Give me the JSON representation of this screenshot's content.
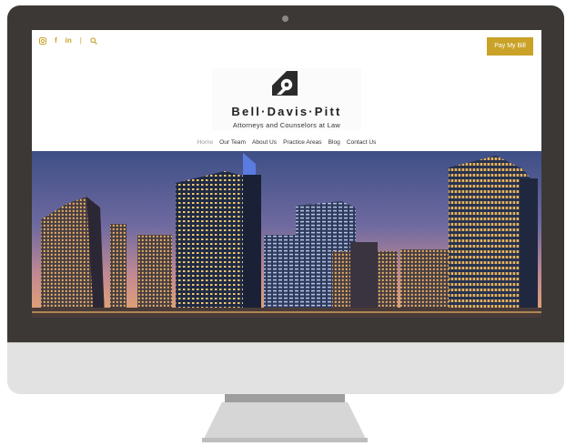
{
  "header": {
    "social_icons": [
      "instagram-icon",
      "facebook-icon",
      "linkedin-icon",
      "search-icon"
    ],
    "facebook_glyph": "f",
    "linkedin_glyph": "in",
    "divider": "|",
    "pay_button_label": "Pay My Bill"
  },
  "logo": {
    "brand": "Bell·Davis·Pitt",
    "tagline": "Attorneys and Counselors at Law"
  },
  "nav": {
    "items": [
      "Home",
      "Our Team",
      "About Us",
      "Practice Areas",
      "Blog",
      "Contact Us"
    ],
    "active_index": 0
  },
  "hero": {
    "image": "city-skyline-at-dusk"
  },
  "colors": {
    "accent_gold": "#c9a227",
    "bezel": "#3b3836",
    "chin": "#e2e2e2"
  }
}
